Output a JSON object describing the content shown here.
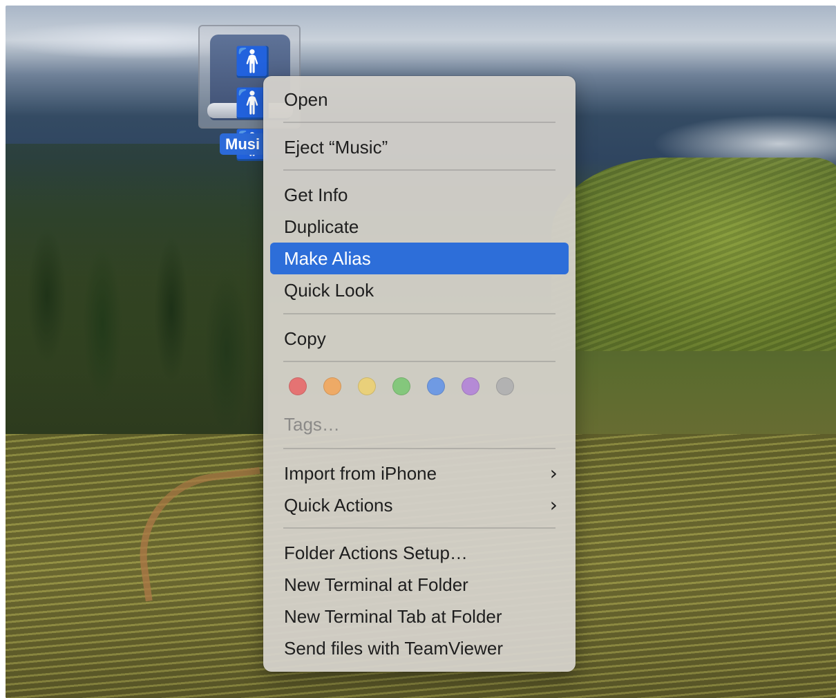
{
  "desktop": {
    "wallpaper_name": "landscape-wallpaper",
    "drive": {
      "label": "Musi",
      "icon": "network-drive-icon",
      "glyph": "👨👨👨"
    }
  },
  "context_menu": {
    "items": [
      {
        "label": "Open"
      },
      {
        "label": "Eject “Music”"
      },
      {
        "label": "Get Info"
      },
      {
        "label": "Duplicate"
      },
      {
        "label": "Make Alias",
        "highlighted": true
      },
      {
        "label": "Quick Look"
      },
      {
        "label": "Copy"
      },
      {
        "label": "Tags…",
        "disabled": true
      },
      {
        "label": "Import from iPhone",
        "submenu": true
      },
      {
        "label": "Quick Actions",
        "submenu": true
      },
      {
        "label": "Folder Actions Setup…"
      },
      {
        "label": "New Terminal at Folder"
      },
      {
        "label": "New Terminal Tab at Folder"
      },
      {
        "label": "Send files with TeamViewer"
      }
    ],
    "submenu_glyph": "›",
    "tag_colors": [
      {
        "name": "red",
        "fill": "#e57373"
      },
      {
        "name": "orange",
        "fill": "#eeaa66"
      },
      {
        "name": "yellow",
        "fill": "#e9d07a"
      },
      {
        "name": "green",
        "fill": "#84c77c"
      },
      {
        "name": "blue",
        "fill": "#6f9ae3"
      },
      {
        "name": "purple",
        "fill": "#b58ad6"
      },
      {
        "name": "gray",
        "fill": "#b2b2b2"
      }
    ],
    "highlight_color": "#2d6ed9"
  }
}
